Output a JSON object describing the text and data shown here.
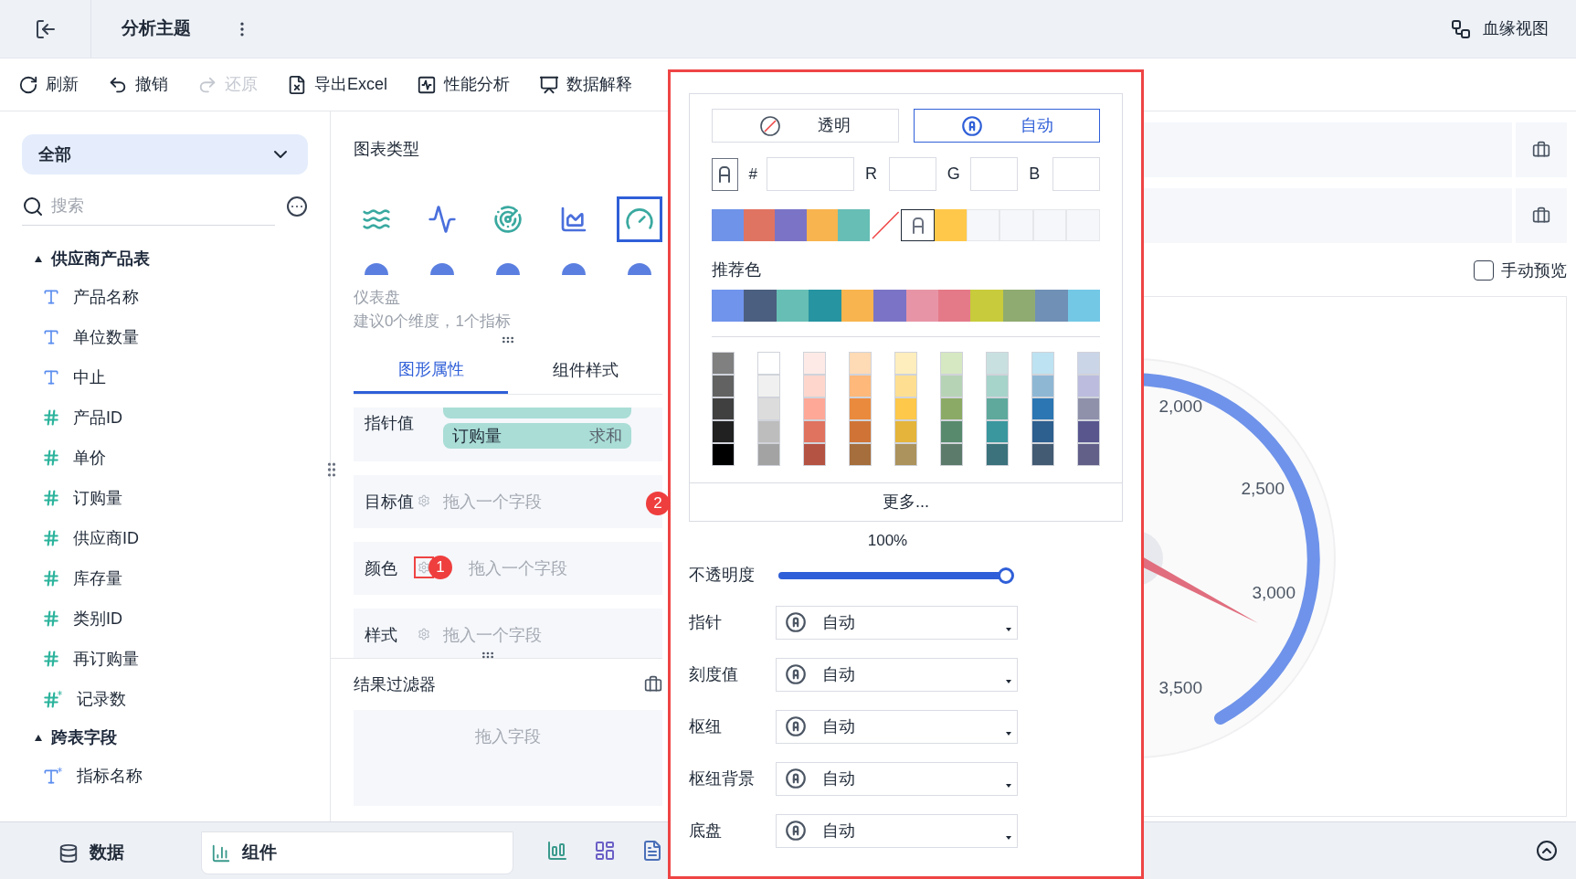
{
  "header": {
    "title": "分析主题",
    "lineage_button": "血缘视图"
  },
  "toolbar": [
    {
      "label": "刷新",
      "disabled": false
    },
    {
      "label": "撤销",
      "disabled": false
    },
    {
      "label": "还原",
      "disabled": true
    },
    {
      "label": "导出Excel",
      "disabled": false
    },
    {
      "label": "性能分析",
      "disabled": false
    },
    {
      "label": "数据解释",
      "disabled": false
    }
  ],
  "sidebar": {
    "scope": "全部",
    "search_placeholder": "搜索",
    "groups": [
      {
        "name": "供应商产品表",
        "expanded": true,
        "children": [
          {
            "name": "产品名称",
            "kind": "text"
          },
          {
            "name": "单位数量",
            "kind": "text"
          },
          {
            "name": "中止",
            "kind": "text"
          },
          {
            "name": "产品ID",
            "kind": "number"
          },
          {
            "name": "单价",
            "kind": "number"
          },
          {
            "name": "订购量",
            "kind": "number"
          },
          {
            "name": "供应商ID",
            "kind": "number"
          },
          {
            "name": "库存量",
            "kind": "number"
          },
          {
            "name": "类别ID",
            "kind": "number"
          },
          {
            "name": "再订购量",
            "kind": "number"
          },
          {
            "name": "记录数",
            "kind": "number_calc"
          }
        ]
      },
      {
        "name": "跨表字段",
        "expanded": true,
        "children": [
          {
            "name": "指标名称",
            "kind": "text_calc"
          }
        ]
      }
    ]
  },
  "chart_types": {
    "title": "图表类型",
    "icons": [
      {
        "selected": false
      },
      {
        "selected": false
      },
      {
        "selected": false
      },
      {
        "selected": false
      },
      {
        "selected": true
      }
    ],
    "name": "仪表盘",
    "hint": "建议0个维度，1个指标"
  },
  "tabs": [
    {
      "label": "图形属性",
      "selected": true
    },
    {
      "label": "组件样式",
      "selected": false
    }
  ],
  "slots": [
    {
      "label": "指针值",
      "fields": [
        {
          "name": "订购量",
          "agg": "求和"
        }
      ]
    },
    {
      "label": "目标值",
      "placeholder": "拖入一个字段",
      "highlighted": false,
      "badge": "2"
    },
    {
      "label": "颜色",
      "placeholder": "拖入一个字段",
      "highlighted": true,
      "badge": "1"
    },
    {
      "label": "样式",
      "placeholder": "拖入一个字段",
      "highlighted": false
    }
  ],
  "result_filter": {
    "title": "结果过滤器",
    "placeholder": "拖入字段"
  },
  "color_picker": {
    "modes": [
      {
        "label": "透明",
        "kind": "transparent",
        "selected": false
      },
      {
        "label": "自动",
        "kind": "auto",
        "selected": true
      }
    ],
    "hex_label": "#",
    "channels": [
      "R",
      "G",
      "B"
    ],
    "recent": [
      {
        "kind": "color",
        "color": "#6f93e9"
      },
      {
        "kind": "color",
        "color": "#e07462"
      },
      {
        "kind": "color",
        "color": "#7b74c6"
      },
      {
        "kind": "color",
        "color": "#f8b44e"
      },
      {
        "kind": "color",
        "color": "#67beb5"
      },
      {
        "kind": "transparent"
      },
      {
        "kind": "auto"
      },
      {
        "kind": "color",
        "color": "#ffc84a"
      },
      {
        "kind": "empty"
      },
      {
        "kind": "empty"
      },
      {
        "kind": "empty"
      },
      {
        "kind": "empty"
      }
    ],
    "recommended_label": "推荐色",
    "recommended": [
      {
        "color": "#7094ec"
      },
      {
        "color": "#4b5f80"
      },
      {
        "color": "#67beb5"
      },
      {
        "color": "#2694a1"
      },
      {
        "color": "#f8b44e"
      },
      {
        "color": "#7b74c6"
      },
      {
        "color": "#e795a6"
      },
      {
        "color": "#e47a88"
      },
      {
        "color": "#c8cb3b"
      },
      {
        "color": "#8fab71"
      },
      {
        "color": "#7090b5"
      },
      {
        "color": "#73c8e6"
      }
    ],
    "palette": [
      {
        "swatches": [
          {
            "color": "#808080"
          },
          {
            "color": "#626262"
          },
          {
            "color": "#404040"
          },
          {
            "color": "#212121"
          },
          {
            "color": "#000000"
          }
        ]
      },
      {
        "swatches": [
          {
            "color": "#ffffff"
          },
          {
            "color": "#f0f0f0"
          },
          {
            "color": "#dcdcdc"
          },
          {
            "color": "#bdbdbd"
          },
          {
            "color": "#a3a3a3"
          }
        ]
      },
      {
        "swatches": [
          {
            "color": "#fdeae6"
          },
          {
            "color": "#fed6cc"
          },
          {
            "color": "#fea898"
          },
          {
            "color": "#df735f"
          },
          {
            "color": "#b45243"
          }
        ]
      },
      {
        "swatches": [
          {
            "color": "#fedab5"
          },
          {
            "color": "#feb87a"
          },
          {
            "color": "#ea8a3d"
          },
          {
            "color": "#cf7436"
          },
          {
            "color": "#a56e3c"
          }
        ]
      },
      {
        "swatches": [
          {
            "color": "#feeebd"
          },
          {
            "color": "#fedf91"
          },
          {
            "color": "#fec84a"
          },
          {
            "color": "#e4b53a"
          },
          {
            "color": "#ac935d"
          }
        ]
      },
      {
        "swatches": [
          {
            "color": "#d6e8c1"
          },
          {
            "color": "#b7d3b6"
          },
          {
            "color": "#8baa65"
          },
          {
            "color": "#588a6e"
          },
          {
            "color": "#5d7b6b"
          }
        ]
      },
      {
        "swatches": [
          {
            "color": "#c8e1e0"
          },
          {
            "color": "#a6d3ca"
          },
          {
            "color": "#5ea99c"
          },
          {
            "color": "#3a979e"
          },
          {
            "color": "#3b727c"
          }
        ]
      },
      {
        "swatches": [
          {
            "color": "#bde2f1"
          },
          {
            "color": "#8eb7d4"
          },
          {
            "color": "#2b76b3"
          },
          {
            "color": "#2d5f8f"
          },
          {
            "color": "#435b73"
          }
        ]
      },
      {
        "swatches": [
          {
            "color": "#cbd5e8"
          },
          {
            "color": "#bbbcde"
          },
          {
            "color": "#8f90aa"
          },
          {
            "color": "#58568d"
          },
          {
            "color": "#625f89"
          }
        ]
      }
    ],
    "more": "更多..."
  },
  "opacity": {
    "label": "不透明度",
    "reading": "100%",
    "level": 1
  },
  "parts": [
    {
      "label": "指针",
      "value": "自动"
    },
    {
      "label": "刻度值",
      "value": "自动"
    },
    {
      "label": "枢纽",
      "value": "自动"
    },
    {
      "label": "枢纽背景",
      "value": "自动"
    },
    {
      "label": "底盘",
      "value": "自动"
    }
  ],
  "manual_preview": {
    "label": "手动预览",
    "checked": false
  },
  "gauge": {
    "tick_labels": [
      "2,000",
      "2,500",
      "3,000",
      "3,500"
    ]
  },
  "bottom_tabs": [
    {
      "label": "数据",
      "selected": false
    },
    {
      "label": "组件",
      "selected": true
    }
  ]
}
